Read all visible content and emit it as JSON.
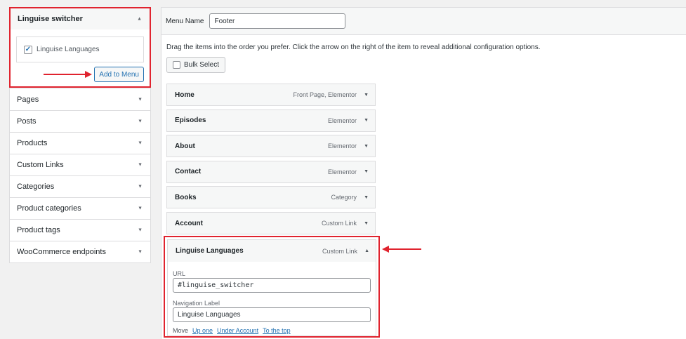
{
  "left": {
    "open_section": {
      "title": "Linguise switcher",
      "checkbox_label": "Linguise Languages",
      "checked": true,
      "add_button": "Add to Menu"
    },
    "sections": [
      "Pages",
      "Posts",
      "Products",
      "Custom Links",
      "Categories",
      "Product categories",
      "Product tags",
      "WooCommerce endpoints"
    ]
  },
  "right": {
    "menu_name_label": "Menu Name",
    "menu_name_value": "Footer",
    "instructions": "Drag the items into the order you prefer. Click the arrow on the right of the item to reveal additional configuration options.",
    "bulk_select": "Bulk Select",
    "items": [
      {
        "title": "Home",
        "type": "Front Page, Elementor"
      },
      {
        "title": "Episodes",
        "type": "Elementor"
      },
      {
        "title": "About",
        "type": "Elementor"
      },
      {
        "title": "Contact",
        "type": "Elementor"
      },
      {
        "title": "Books",
        "type": "Category"
      },
      {
        "title": "Account",
        "type": "Custom Link"
      }
    ],
    "expanded_item": {
      "title": "Linguise Languages",
      "type": "Custom Link",
      "url_label": "URL",
      "url_value": "#linguise_switcher",
      "nav_label": "Navigation Label",
      "nav_value": "Linguise Languages",
      "move_label": "Move",
      "move_links": [
        "Up one",
        "Under Account",
        "To the top"
      ]
    }
  },
  "colors": {
    "highlight": "#e0232e",
    "link": "#2271b1"
  },
  "icons": {
    "collapse": "chevron-up-icon",
    "expand": "chevron-down-icon",
    "checkmark": "checkmark-icon",
    "annotation": "red-arrow-icon"
  }
}
